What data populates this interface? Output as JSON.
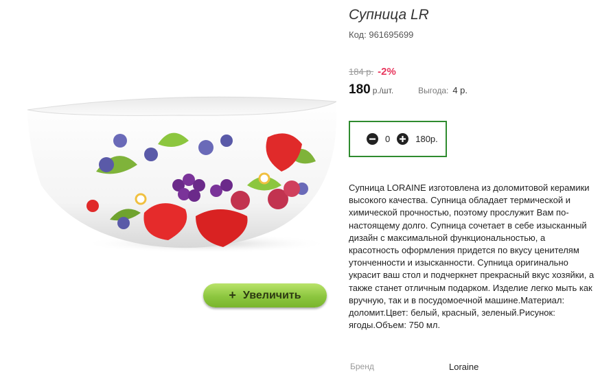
{
  "product": {
    "title": "Супница LR",
    "code_label": "Код:",
    "code_value": "961695699",
    "old_price": "184 р.",
    "discount": "-2%",
    "price": "180",
    "price_unit": "р./шт.",
    "benefit_label": "Выгода:",
    "benefit_value": "4 р.",
    "description": "Супница LORAINE изготовлена из доломитовой керамики высокого качества. Супница обладает термической и химической прочностью, поэтому прослужит Вам по-настоящему долго. Супница сочетает в себе изысканный дизайн с максимальной функциональностью, а красотность оформления придется по вкусу ценителям утонченности и изысканности. Супница оригинально украсит ваш стол и подчеркнет прекрасный вкус хозяйки, а также станет отличным подарком. Изделие легко мыть как вручную, так и в посудомоечной машине.Материал: доломит.Цвет: белый, красный, зеленый.Рисунок: ягоды.Объем: 750 мл.",
    "brand_label": "Бренд",
    "brand_value": "Loraine"
  },
  "cart": {
    "minus_icon": "minus-circle-icon",
    "plus_icon": "plus-circle-icon",
    "quantity": "0",
    "sum": "180р."
  },
  "image": {
    "zoom_icon": "+",
    "zoom_label": "Увеличить"
  },
  "colors": {
    "discount": "#e8365d",
    "cart_border": "#2e8b2e",
    "zoom_button": "#8cc63f"
  }
}
